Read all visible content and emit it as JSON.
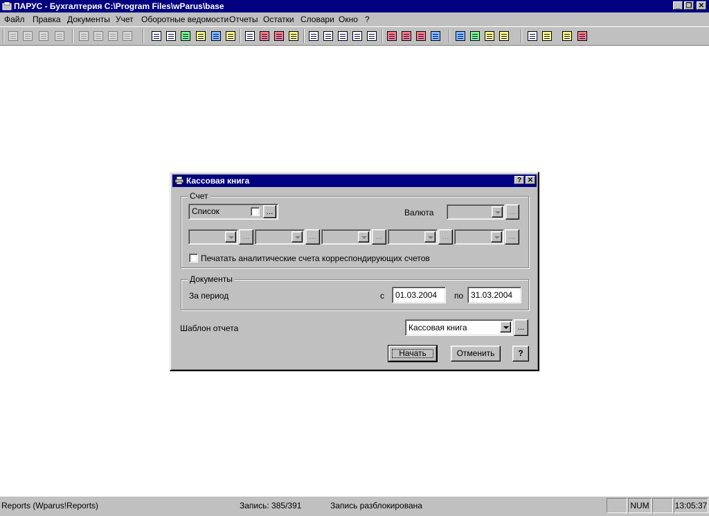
{
  "window": {
    "title": "ПАРУС - Бухгалтерия  C:\\Program Files\\wParus\\base",
    "minimize_glyph": "_",
    "restore_glyph": "❐",
    "close_glyph": "✕"
  },
  "menu": {
    "items": [
      "Файл",
      "Правка",
      "Документы",
      "Учет",
      "Оборотные ведомости",
      "Отчеты",
      "Остатки",
      "Словари",
      "Окно",
      "?"
    ]
  },
  "toolbar": {
    "icons": [
      "new-doc-icon",
      "copy-doc-icon",
      "edit-doc-icon",
      "delete-icon",
      "filter-icon",
      "sort-icon",
      "print-icon",
      "print-setup-icon",
      "accounts-icon",
      "cards-icon",
      "analytics-icon",
      "folder-icon",
      "journal-icon",
      "table-icon",
      "operations-icon",
      "entries-icon",
      "rates-icon",
      "doc-report-1-icon",
      "doc-report-2-icon",
      "doc-report-3-icon",
      "doc-report-4-icon",
      "doc-report-5-icon",
      "balance-1-icon",
      "balance-2-icon",
      "balance-3-icon",
      "balance-4-icon",
      "currency-icon",
      "people-icon",
      "organizations-icon",
      "dictionary-icon",
      "calculator-icon",
      "calendar-icon",
      "help-icon",
      "exit-icon"
    ]
  },
  "dialog": {
    "title": "Кассовая книга",
    "help_glyph": "?",
    "close_glyph": "✕",
    "account_group": {
      "label": "Счет",
      "list_label": "Список",
      "list_checked": false,
      "ellipsis": "...",
      "currency_label": "Валюта",
      "currency_value": ""
    },
    "analytics_checkbox": {
      "label": "Печатать аналитические счета корреспондирующих счетов",
      "checked": false
    },
    "documents_group": {
      "label": "Документы",
      "period_label": "За период",
      "from_label": "с",
      "from_value": "01.03.2004",
      "to_label": "по",
      "to_value": "31.03.2004"
    },
    "template": {
      "label": "Шаблон отчета",
      "value": "Кассовая книга",
      "ellipsis": "..."
    },
    "buttons": {
      "start": "Начать",
      "cancel": "Отменить",
      "help": "?"
    }
  },
  "statusbar": {
    "module": "Reports (Wparus!Reports)",
    "record": "Запись: 385/391",
    "lock_state": "Запись разблокирована",
    "num": "NUM",
    "time": "13:05:37"
  }
}
